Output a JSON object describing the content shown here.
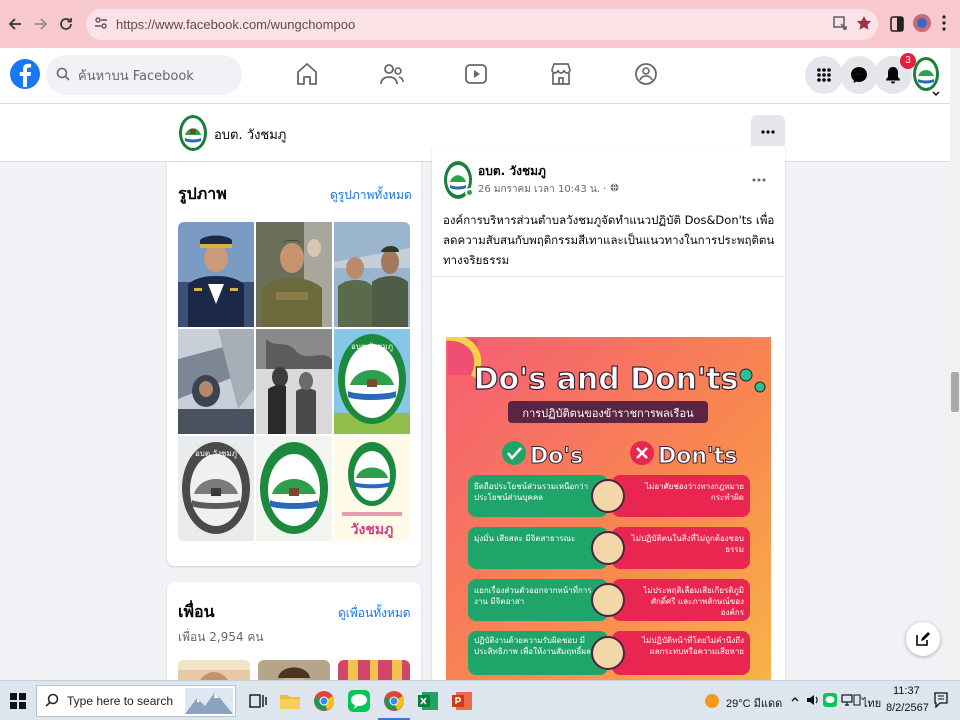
{
  "browser": {
    "url": "https://www.facebook.com/wungchompoo"
  },
  "fb": {
    "search_placeholder": "ค้นหาบน Facebook",
    "notification_count": "3"
  },
  "page": {
    "name": "อบต. วังชมภู"
  },
  "photos": {
    "title": "รูปภาพ",
    "see_all": "ดูรูปภาพทั้งหมด",
    "tile3_text": "วังชมภู",
    "tile2_1_text": "อบต.วังชมภู",
    "tile2_2_text": "อบต.วังชมภู"
  },
  "friends": {
    "title": "เพื่อน",
    "see_all": "ดูเพื่อนทั้งหมด",
    "count": "เพื่อน 2,954 คน"
  },
  "post": {
    "author": "อบต. วังชมภู",
    "meta": "26 มกราคม เวลา 10:43 น. ·",
    "text": "องค์การบริหารส่วนตำบลวังชมภูจัดทำแนวปฏิบัติ Dos&Don'ts เพื่อลดความสับสนกับพฤติกรรมสีเทาและเป็นแนวทางในการประพฤติตนทางจริยธรรม",
    "poster": {
      "title": "Do's and Don'ts",
      "subtitle": "การปฏิบัติตนของข้าราชการพลเรือน",
      "dos_label": "Do's",
      "donts_label": "Don'ts",
      "rows": [
        {
          "do": "ยึดถือประโยชน์ส่วนรวมเหนือกว่าประโยชน์ส่วนบุคคล",
          "dont": "ไม่อาศัยช่องว่างทางกฎหมายกระทำผิด"
        },
        {
          "do": "มุ่งมั่น เสียสละ มีจิตสาธารณะ",
          "dont": "ไม่ปฏิบัติตนในสิ่งที่ไม่ถูกต้องชอบธรรม"
        },
        {
          "do": "แยกเรื่องส่วนตัวออกจากหน้าที่การงาน มีจิตอาสา",
          "dont": "ไม่ประพฤติเลื่อมเสียเกียรติภูมิศักดิ์ศรี และภาพลักษณ์ขององค์กร"
        },
        {
          "do": "ปฏิบัติงานด้วยความรับผิดชอบ มีประสิทธิภาพ เพื่อให้งานสัมฤทธิ์ผล",
          "dont": "ไม่ปฏิบัติหน้าที่โดยไม่คำนึงถึงผลกระทบหรือความเสียหาย"
        }
      ]
    }
  },
  "taskbar": {
    "search_placeholder": "Type here to search",
    "weather": "29°C  มีแดด",
    "language": "ไทย",
    "time": "11:37",
    "date": "8/2/2567"
  },
  "colors": {
    "fb_blue": "#1877f2",
    "link": "#1b74e4",
    "badge": "#e41e3f",
    "chrome_bar": "#f7c9cf"
  }
}
